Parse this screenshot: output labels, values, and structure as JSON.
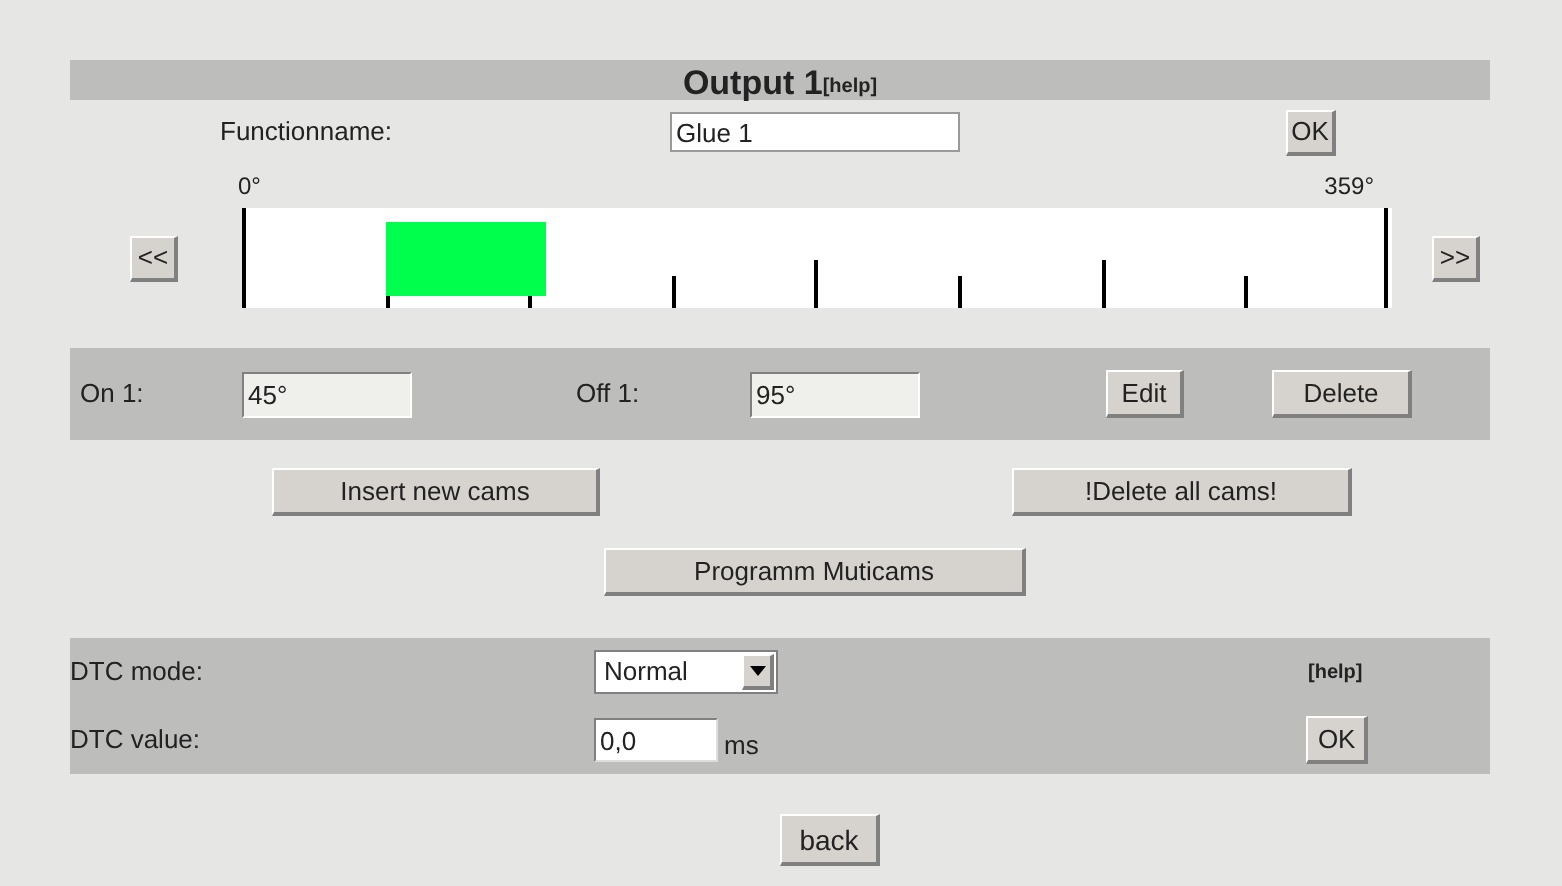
{
  "title": "Output 1",
  "title_help": "[help]",
  "function_name": {
    "label": "Functionname:",
    "value": "Glue 1",
    "ok": "OK"
  },
  "timeline": {
    "start_label": "0°",
    "end_label": "359°",
    "prev": "<<",
    "next": ">>"
  },
  "cams": [
    {
      "on_label": "On 1:",
      "on": "45°",
      "off_label": "Off 1:",
      "off": "95°",
      "edit": "Edit",
      "delete": "Delete"
    }
  ],
  "actions": {
    "insert": "Insert new cams",
    "delete_all": "!Delete all cams!",
    "program": "Programm Muticams"
  },
  "dtc": {
    "mode_label": "DTC mode:",
    "mode": "Normal",
    "help": "[help]",
    "value_label": "DTC value:",
    "value": "0,0",
    "unit": "ms",
    "ok": "OK"
  },
  "back": "back"
}
